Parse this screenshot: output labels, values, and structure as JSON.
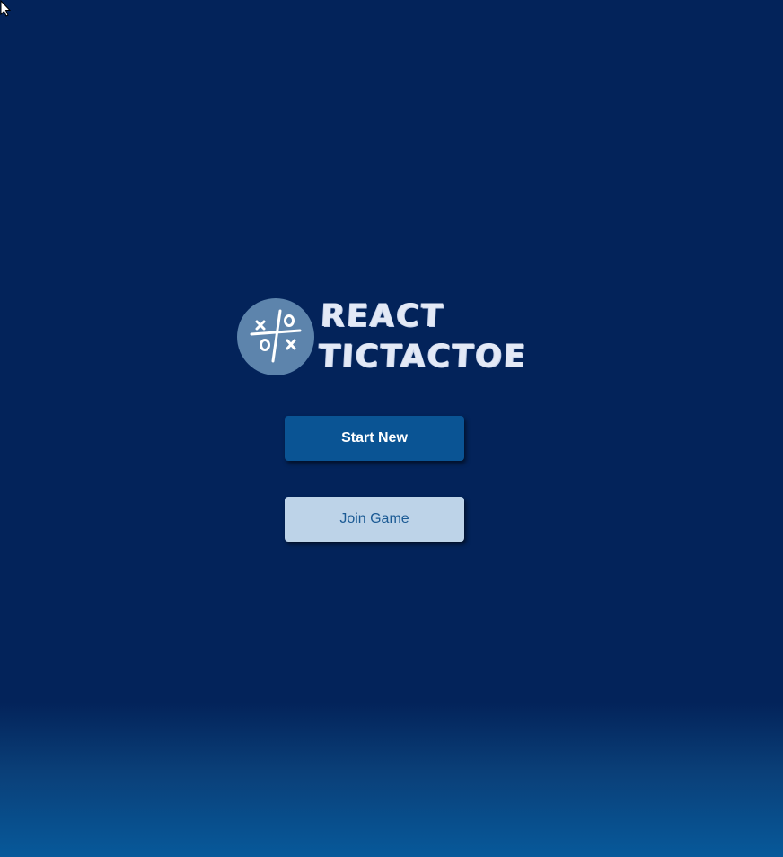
{
  "app": {
    "logo_line1": "REACT",
    "logo_line2": "TICTACTOE",
    "logo_icon": "tictactoe-board-icon"
  },
  "buttons": {
    "start_new_label": "Start New",
    "join_game_label": "Join Game"
  },
  "colors": {
    "background": "#03235a",
    "background_bottom": "#07599a",
    "primary_button": "#0a5494",
    "secondary_button": "#bdd3e8",
    "logo_badge": "#5d84ac"
  }
}
